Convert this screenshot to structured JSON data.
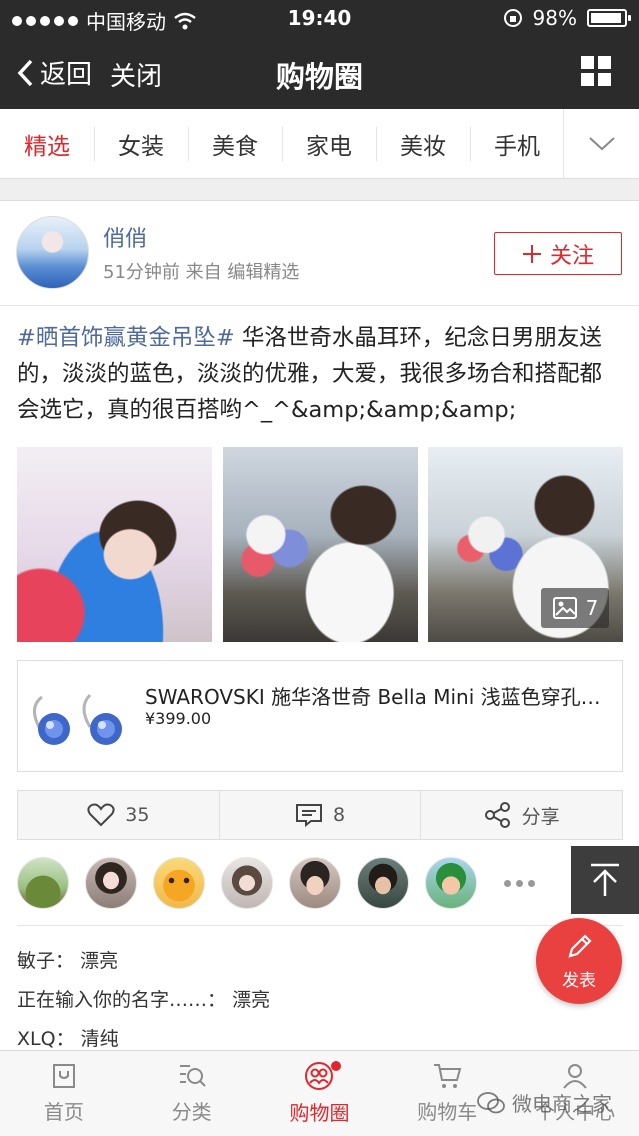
{
  "status_bar": {
    "carrier": "中国移动",
    "time": "19:40",
    "battery": "98%"
  },
  "nav": {
    "back_label": "返回",
    "close_label": "关闭",
    "title": "购物圈"
  },
  "tabs": [
    "精选",
    "女装",
    "美食",
    "家电",
    "美妆",
    "手机"
  ],
  "post": {
    "author": "俏俏",
    "meta": "51分钟前 来自 编辑精选",
    "follow_label": "关注",
    "hashtag": "#晒首饰赢黄金吊坠#",
    "text": " 华洛世奇水晶耳环，纪念日男朋友送的，淡淡的蓝色，淡淡的优雅，大爱，我很多场合和搭配都会选它，真的很百搭哟^_^&amp;&amp;&amp;",
    "photo_count": "7"
  },
  "product": {
    "name": "SWAROVSKI 施华洛世奇 Bella Mini 浅蓝色穿孔耳环",
    "price": "¥399.00"
  },
  "actions": {
    "likes": "35",
    "comments": "8",
    "share_label": "分享"
  },
  "comments": [
    {
      "user": "敏子",
      "text": "漂亮"
    },
    {
      "user": "正在输入你的名字……",
      "text": "漂亮"
    },
    {
      "user": "XLQ",
      "text": "清纯"
    }
  ],
  "fab_label": "发表",
  "bottom_tabs": [
    "首页",
    "分类",
    "购物圈",
    "购物车",
    "个人中心"
  ],
  "watermark": "微电商之家",
  "colors": {
    "accent": "#e1272c",
    "link": "#4f6a9a",
    "header": "#2b2b2b"
  }
}
